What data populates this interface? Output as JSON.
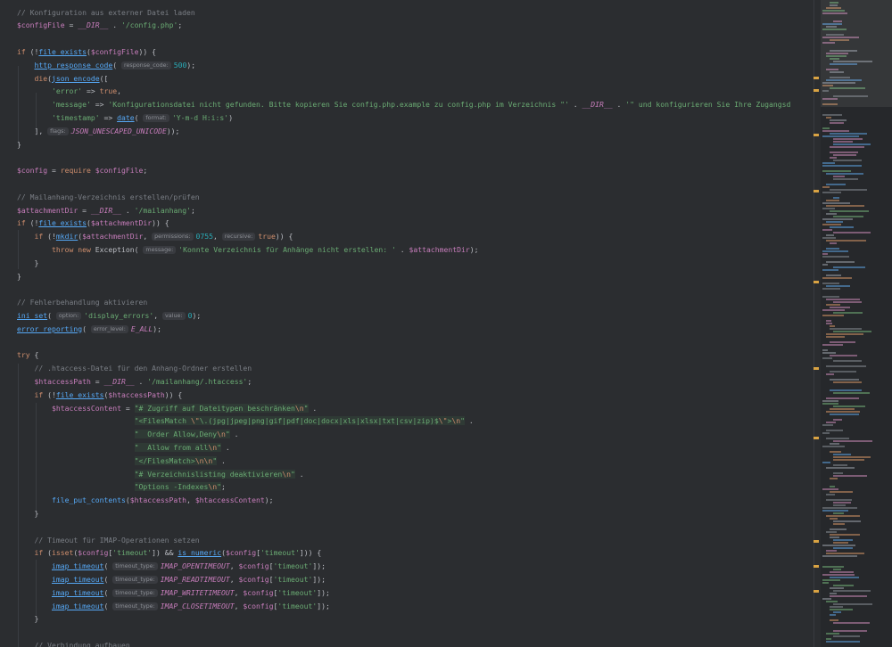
{
  "editor": {
    "lines": [
      [
        {
          "t": "// Konfiguration aus externer Datei laden",
          "c": "cm"
        }
      ],
      [
        {
          "t": "$configFile",
          "c": "var"
        },
        {
          "t": " = ",
          "c": "plain"
        },
        {
          "t": "__DIR__",
          "c": "const"
        },
        {
          "t": " . ",
          "c": "plain"
        },
        {
          "t": "'/config.php'",
          "c": "str"
        },
        {
          "t": ";",
          "c": "plain"
        }
      ],
      [],
      [
        {
          "t": "if",
          "c": "kw"
        },
        {
          "t": " (!",
          "c": "plain"
        },
        {
          "t": "file_exists",
          "c": "fn"
        },
        {
          "t": "(",
          "c": "plain"
        },
        {
          "t": "$configFile",
          "c": "var"
        },
        {
          "t": ")) {",
          "c": "plain"
        }
      ],
      [
        {
          "t": "    ",
          "c": "plain"
        },
        {
          "t": "http_response_code",
          "c": "fn"
        },
        {
          "t": "( ",
          "c": "plain"
        },
        {
          "t": "response_code:",
          "c": "hint"
        },
        {
          "t": "500",
          "c": "num"
        },
        {
          "t": ");",
          "c": "plain"
        }
      ],
      [
        {
          "t": "    ",
          "c": "plain"
        },
        {
          "t": "die",
          "c": "kw"
        },
        {
          "t": "(",
          "c": "plain"
        },
        {
          "t": "json_encode",
          "c": "fn"
        },
        {
          "t": "([",
          "c": "plain"
        }
      ],
      [
        {
          "t": "        ",
          "c": "plain"
        },
        {
          "t": "'error'",
          "c": "str"
        },
        {
          "t": " => ",
          "c": "plain"
        },
        {
          "t": "true",
          "c": "kw"
        },
        {
          "t": ",",
          "c": "plain"
        }
      ],
      [
        {
          "t": "        ",
          "c": "plain"
        },
        {
          "t": "'message'",
          "c": "str"
        },
        {
          "t": " => ",
          "c": "plain"
        },
        {
          "t": "'Konfigurationsdatei nicht gefunden. Bitte kopieren Sie config.php.example zu config.php im Verzeichnis \"'",
          "c": "str"
        },
        {
          "t": " . ",
          "c": "plain"
        },
        {
          "t": "__DIR__",
          "c": "const"
        },
        {
          "t": " . ",
          "c": "plain"
        },
        {
          "t": "'\" und konfigurieren Sie Ihre Zugangsd",
          "c": "str"
        }
      ],
      [
        {
          "t": "        ",
          "c": "plain"
        },
        {
          "t": "'timestamp'",
          "c": "str"
        },
        {
          "t": " => ",
          "c": "plain"
        },
        {
          "t": "date",
          "c": "fn"
        },
        {
          "t": "( ",
          "c": "plain"
        },
        {
          "t": "format:",
          "c": "hint"
        },
        {
          "t": "'Y-m-d H:i:s'",
          "c": "str"
        },
        {
          "t": ")",
          "c": "plain"
        }
      ],
      [
        {
          "t": "    ], ",
          "c": "plain"
        },
        {
          "t": "flags:",
          "c": "hint"
        },
        {
          "t": "JSON_UNESCAPED_UNICODE",
          "c": "const"
        },
        {
          "t": "));",
          "c": "plain"
        }
      ],
      [
        {
          "t": "}",
          "c": "plain"
        }
      ],
      [],
      [
        {
          "t": "$config",
          "c": "var"
        },
        {
          "t": " = ",
          "c": "plain"
        },
        {
          "t": "require",
          "c": "kw"
        },
        {
          "t": " ",
          "c": "plain"
        },
        {
          "t": "$configFile",
          "c": "var"
        },
        {
          "t": ";",
          "c": "plain"
        }
      ],
      [],
      [
        {
          "t": "// Mailanhang-Verzeichnis erstellen/prüfen",
          "c": "cm"
        }
      ],
      [
        {
          "t": "$attachmentDir",
          "c": "var"
        },
        {
          "t": " = ",
          "c": "plain"
        },
        {
          "t": "__DIR__",
          "c": "const"
        },
        {
          "t": " . ",
          "c": "plain"
        },
        {
          "t": "'/mailanhang'",
          "c": "str"
        },
        {
          "t": ";",
          "c": "plain"
        }
      ],
      [
        {
          "t": "if",
          "c": "kw"
        },
        {
          "t": " (!",
          "c": "plain"
        },
        {
          "t": "file_exists",
          "c": "fn"
        },
        {
          "t": "(",
          "c": "plain"
        },
        {
          "t": "$attachmentDir",
          "c": "var"
        },
        {
          "t": ")) {",
          "c": "plain"
        }
      ],
      [
        {
          "t": "    ",
          "c": "plain"
        },
        {
          "t": "if",
          "c": "kw"
        },
        {
          "t": " (!",
          "c": "plain"
        },
        {
          "t": "mkdir",
          "c": "fn"
        },
        {
          "t": "(",
          "c": "plain"
        },
        {
          "t": "$attachmentDir",
          "c": "var"
        },
        {
          "t": ", ",
          "c": "plain"
        },
        {
          "t": "permissions:",
          "c": "hint"
        },
        {
          "t": "0755",
          "c": "num"
        },
        {
          "t": ", ",
          "c": "plain"
        },
        {
          "t": "recursive:",
          "c": "hint"
        },
        {
          "t": "true",
          "c": "kw"
        },
        {
          "t": ")) {",
          "c": "plain"
        }
      ],
      [
        {
          "t": "        ",
          "c": "plain"
        },
        {
          "t": "throw",
          "c": "kw"
        },
        {
          "t": " ",
          "c": "plain"
        },
        {
          "t": "new",
          "c": "kw"
        },
        {
          "t": " Exception( ",
          "c": "plain"
        },
        {
          "t": "message:",
          "c": "hint"
        },
        {
          "t": "'Konnte Verzeichnis für Anhänge nicht erstellen: '",
          "c": "str"
        },
        {
          "t": " . ",
          "c": "plain"
        },
        {
          "t": "$attachmentDir",
          "c": "var"
        },
        {
          "t": ");",
          "c": "plain"
        }
      ],
      [
        {
          "t": "    }",
          "c": "plain"
        }
      ],
      [
        {
          "t": "}",
          "c": "plain"
        }
      ],
      [],
      [
        {
          "t": "// Fehlerbehandlung aktivieren",
          "c": "cm"
        }
      ],
      [
        {
          "t": "ini_set",
          "c": "fn"
        },
        {
          "t": "( ",
          "c": "plain"
        },
        {
          "t": "option:",
          "c": "hint"
        },
        {
          "t": "'display_errors'",
          "c": "str"
        },
        {
          "t": ", ",
          "c": "plain"
        },
        {
          "t": "value:",
          "c": "hint"
        },
        {
          "t": "0",
          "c": "num"
        },
        {
          "t": ");",
          "c": "plain"
        }
      ],
      [
        {
          "t": "error_reporting",
          "c": "fn"
        },
        {
          "t": "( ",
          "c": "plain"
        },
        {
          "t": "error_level:",
          "c": "hint"
        },
        {
          "t": "E_ALL",
          "c": "const"
        },
        {
          "t": ");",
          "c": "plain"
        }
      ],
      [],
      [
        {
          "t": "try",
          "c": "kw"
        },
        {
          "t": " {",
          "c": "plain"
        }
      ],
      [
        {
          "t": "    ",
          "c": "plain"
        },
        {
          "t": "// .htaccess-Datei für den Anhang-Ordner erstellen",
          "c": "cm"
        }
      ],
      [
        {
          "t": "    ",
          "c": "plain"
        },
        {
          "t": "$htaccessPath",
          "c": "var"
        },
        {
          "t": " = ",
          "c": "plain"
        },
        {
          "t": "__DIR__",
          "c": "const"
        },
        {
          "t": " . ",
          "c": "plain"
        },
        {
          "t": "'/mailanhang/.htaccess'",
          "c": "str"
        },
        {
          "t": ";",
          "c": "plain"
        }
      ],
      [
        {
          "t": "    ",
          "c": "plain"
        },
        {
          "t": "if",
          "c": "kw"
        },
        {
          "t": " (!",
          "c": "plain"
        },
        {
          "t": "file_exists",
          "c": "fn"
        },
        {
          "t": "(",
          "c": "plain"
        },
        {
          "t": "$htaccessPath",
          "c": "var"
        },
        {
          "t": ")) {",
          "c": "plain"
        }
      ],
      [
        {
          "t": "        ",
          "c": "plain"
        },
        {
          "t": "$htaccessContent",
          "c": "var"
        },
        {
          "t": " = ",
          "c": "plain"
        },
        {
          "t": "\"# Zugriff auf Dateitypen beschränken",
          "c": "str strhl"
        },
        {
          "t": "\\n",
          "c": "esc strhl"
        },
        {
          "t": "\"",
          "c": "str strhl"
        },
        {
          "t": " .",
          "c": "plain"
        }
      ],
      [
        {
          "t": "                           ",
          "c": "plain"
        },
        {
          "t": "\"<FilesMatch ",
          "c": "str strhl"
        },
        {
          "t": "\\\"",
          "c": "esc strhl"
        },
        {
          "t": "\\.(jpg|jpeg|png|gif|pdf|doc|docx|xls|xlsx|txt|csv|zip)$",
          "c": "str strhl"
        },
        {
          "t": "\\\"",
          "c": "esc strhl"
        },
        {
          "t": ">",
          "c": "str strhl"
        },
        {
          "t": "\\n",
          "c": "esc strhl"
        },
        {
          "t": "\"",
          "c": "str strhl"
        },
        {
          "t": " .",
          "c": "plain"
        }
      ],
      [
        {
          "t": "                           ",
          "c": "plain"
        },
        {
          "t": "\"  Order Allow,Deny",
          "c": "str strhl"
        },
        {
          "t": "\\n",
          "c": "esc strhl"
        },
        {
          "t": "\"",
          "c": "str strhl"
        },
        {
          "t": " .",
          "c": "plain"
        }
      ],
      [
        {
          "t": "                           ",
          "c": "plain"
        },
        {
          "t": "\"  Allow from all",
          "c": "str strhl"
        },
        {
          "t": "\\n",
          "c": "esc strhl"
        },
        {
          "t": "\"",
          "c": "str strhl"
        },
        {
          "t": " .",
          "c": "plain"
        }
      ],
      [
        {
          "t": "                           ",
          "c": "plain"
        },
        {
          "t": "\"</FilesMatch>",
          "c": "str strhl"
        },
        {
          "t": "\\n\\n",
          "c": "esc strhl"
        },
        {
          "t": "\"",
          "c": "str strhl"
        },
        {
          "t": " .",
          "c": "plain"
        }
      ],
      [
        {
          "t": "                           ",
          "c": "plain"
        },
        {
          "t": "\"# Verzeichnislisting deaktivieren",
          "c": "str strhl"
        },
        {
          "t": "\\n",
          "c": "esc strhl"
        },
        {
          "t": "\"",
          "c": "str strhl"
        },
        {
          "t": " .",
          "c": "plain"
        }
      ],
      [
        {
          "t": "                           ",
          "c": "plain"
        },
        {
          "t": "\"Options -Indexes",
          "c": "str strhl"
        },
        {
          "t": "\\n",
          "c": "esc strhl"
        },
        {
          "t": "\"",
          "c": "str strhl"
        },
        {
          "t": ";",
          "c": "plain"
        }
      ],
      [
        {
          "t": "        ",
          "c": "plain"
        },
        {
          "t": "file_put_contents",
          "c": "fnp"
        },
        {
          "t": "(",
          "c": "plain"
        },
        {
          "t": "$htaccessPath",
          "c": "var"
        },
        {
          "t": ", ",
          "c": "plain"
        },
        {
          "t": "$htaccessContent",
          "c": "var"
        },
        {
          "t": ");",
          "c": "plain"
        }
      ],
      [
        {
          "t": "    }",
          "c": "plain"
        }
      ],
      [],
      [
        {
          "t": "    ",
          "c": "plain"
        },
        {
          "t": "// Timeout für IMAP-Operationen setzen",
          "c": "cm"
        }
      ],
      [
        {
          "t": "    ",
          "c": "plain"
        },
        {
          "t": "if",
          "c": "kw"
        },
        {
          "t": " (",
          "c": "plain"
        },
        {
          "t": "isset",
          "c": "kw"
        },
        {
          "t": "(",
          "c": "plain"
        },
        {
          "t": "$config",
          "c": "var"
        },
        {
          "t": "[",
          "c": "plain"
        },
        {
          "t": "'timeout'",
          "c": "str"
        },
        {
          "t": "]) && ",
          "c": "plain"
        },
        {
          "t": "is_numeric",
          "c": "fn"
        },
        {
          "t": "(",
          "c": "plain"
        },
        {
          "t": "$config",
          "c": "var"
        },
        {
          "t": "[",
          "c": "plain"
        },
        {
          "t": "'timeout'",
          "c": "str"
        },
        {
          "t": "])) {",
          "c": "plain"
        }
      ],
      [
        {
          "t": "        ",
          "c": "plain"
        },
        {
          "t": "imap_timeout",
          "c": "fn"
        },
        {
          "t": "( ",
          "c": "plain"
        },
        {
          "t": "timeout_type:",
          "c": "hint"
        },
        {
          "t": "IMAP_OPENTIMEOUT",
          "c": "const"
        },
        {
          "t": ", ",
          "c": "plain"
        },
        {
          "t": "$config",
          "c": "var"
        },
        {
          "t": "[",
          "c": "plain"
        },
        {
          "t": "'timeout'",
          "c": "str"
        },
        {
          "t": "]);",
          "c": "plain"
        }
      ],
      [
        {
          "t": "        ",
          "c": "plain"
        },
        {
          "t": "imap_timeout",
          "c": "fn"
        },
        {
          "t": "( ",
          "c": "plain"
        },
        {
          "t": "timeout_type:",
          "c": "hint"
        },
        {
          "t": "IMAP_READTIMEOUT",
          "c": "const"
        },
        {
          "t": ", ",
          "c": "plain"
        },
        {
          "t": "$config",
          "c": "var"
        },
        {
          "t": "[",
          "c": "plain"
        },
        {
          "t": "'timeout'",
          "c": "str"
        },
        {
          "t": "]);",
          "c": "plain"
        }
      ],
      [
        {
          "t": "        ",
          "c": "plain"
        },
        {
          "t": "imap_timeout",
          "c": "fn"
        },
        {
          "t": "( ",
          "c": "plain"
        },
        {
          "t": "timeout_type:",
          "c": "hint"
        },
        {
          "t": "IMAP_WRITETIMEOUT",
          "c": "const"
        },
        {
          "t": ", ",
          "c": "plain"
        },
        {
          "t": "$config",
          "c": "var"
        },
        {
          "t": "[",
          "c": "plain"
        },
        {
          "t": "'timeout'",
          "c": "str"
        },
        {
          "t": "]);",
          "c": "plain"
        }
      ],
      [
        {
          "t": "        ",
          "c": "plain"
        },
        {
          "t": "imap_timeout",
          "c": "fn"
        },
        {
          "t": "( ",
          "c": "plain"
        },
        {
          "t": "timeout_type:",
          "c": "hint"
        },
        {
          "t": "IMAP_CLOSETIMEOUT",
          "c": "const"
        },
        {
          "t": ", ",
          "c": "plain"
        },
        {
          "t": "$config",
          "c": "var"
        },
        {
          "t": "[",
          "c": "plain"
        },
        {
          "t": "'timeout'",
          "c": "str"
        },
        {
          "t": "]);",
          "c": "plain"
        }
      ],
      [
        {
          "t": "    }",
          "c": "plain"
        }
      ],
      [],
      [
        {
          "t": "    ",
          "c": "plain"
        },
        {
          "t": "// Verbindung aufbauen",
          "c": "cm"
        }
      ]
    ]
  },
  "colors": {
    "background": "#2b2d30",
    "comment": "#7a7e85",
    "keyword": "#cf8e6d",
    "string": "#6aab73",
    "variable": "#c77dbb",
    "function": "#56a8f5",
    "number": "#2aacb8",
    "marker": "#d9a343"
  }
}
